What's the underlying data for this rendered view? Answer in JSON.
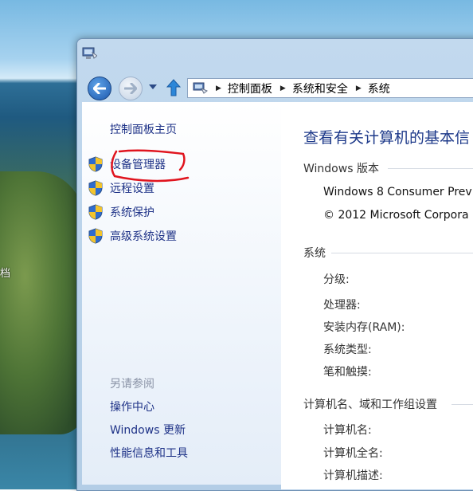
{
  "desktop": {
    "side_text": "档"
  },
  "address": {
    "crumbs": [
      "控制面板",
      "系统和安全",
      "系统"
    ]
  },
  "left_pane": {
    "home_link": "控制面板主页",
    "tasks": [
      "设备管理器",
      "远程设置",
      "系统保护",
      "高级系统设置"
    ],
    "see_also_header": "另请参阅",
    "see_also": [
      "操作中心",
      "Windows 更新",
      "性能信息和工具"
    ]
  },
  "main": {
    "title": "查看有关计算机的基本信",
    "edition_section": "Windows 版本",
    "edition_name": "Windows 8 Consumer Prev",
    "copyright": "© 2012 Microsoft Corpora",
    "system_section": "系统",
    "system_fields": [
      "分级:",
      "处理器:",
      "安装内存(RAM):",
      "系统类型:",
      "笔和触摸:"
    ],
    "computer_section": "计算机名、域和工作组设置",
    "computer_fields": [
      "计算机名:",
      "计算机全名:",
      "计算机描述:"
    ]
  },
  "colors": {
    "link": "#1e3287",
    "title": "#1e3a8a",
    "annotation": "#e0141e"
  },
  "icons": [
    "system-icon",
    "back-arrow-icon",
    "forward-arrow-icon",
    "dropdown-icon",
    "up-arrow-icon",
    "shield-icon"
  ]
}
